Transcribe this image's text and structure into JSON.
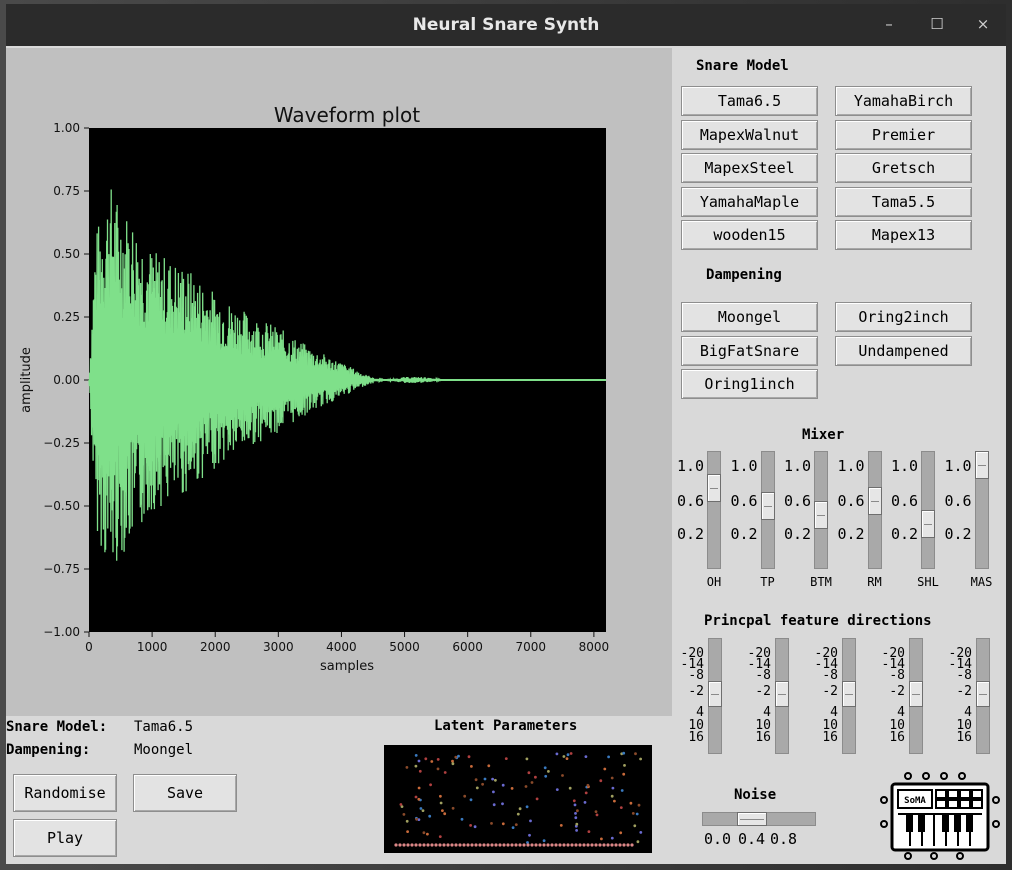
{
  "window": {
    "title": "Neural Snare Synth",
    "minimize": "–",
    "maximize": "☐",
    "close": "×"
  },
  "plot": {
    "title": "Waveform plot",
    "xlabel": "samples",
    "ylabel": "amplitude",
    "xticks": [
      "0",
      "1000",
      "2000",
      "3000",
      "4000",
      "5000",
      "6000",
      "7000",
      "8000"
    ],
    "yticks": [
      "1.00",
      "0.75",
      "0.50",
      "0.25",
      "0.00",
      "−0.25",
      "−0.50",
      "−0.75",
      "−1.00"
    ],
    "line_color": "#7fe08a",
    "background": "#000000"
  },
  "chart_data": {
    "type": "line",
    "title": "Waveform plot",
    "xlabel": "samples",
    "ylabel": "amplitude",
    "xlim": [
      0,
      8192
    ],
    "ylim": [
      -1.0,
      1.0
    ],
    "series": [
      {
        "color": "#7fe08a",
        "envelope": [
          {
            "x": 0,
            "y": 0.0
          },
          {
            "x": 100,
            "y": 0.58
          },
          {
            "x": 200,
            "y": 0.67
          },
          {
            "x": 330,
            "y": 0.79
          },
          {
            "x": 500,
            "y": 0.7
          },
          {
            "x": 700,
            "y": 0.65
          },
          {
            "x": 1000,
            "y": 0.52
          },
          {
            "x": 1500,
            "y": 0.46
          },
          {
            "x": 2000,
            "y": 0.35
          },
          {
            "x": 2500,
            "y": 0.27
          },
          {
            "x": 3000,
            "y": 0.21
          },
          {
            "x": 3500,
            "y": 0.13
          },
          {
            "x": 4000,
            "y": 0.07
          },
          {
            "x": 4400,
            "y": 0.02
          },
          {
            "x": 4700,
            "y": 0.0
          },
          {
            "x": 5000,
            "y": 0.02
          },
          {
            "x": 5300,
            "y": 0.02
          },
          {
            "x": 5600,
            "y": 0.0
          },
          {
            "x": 8192,
            "y": 0.0
          }
        ]
      }
    ]
  },
  "snare_model": {
    "heading": "Snare Model",
    "options": [
      "Tama6.5",
      "YamahaBirch",
      "MapexWalnut",
      "Premier",
      "MapexSteel",
      "Gretsch",
      "YamahaMaple",
      "Tama5.5",
      "wooden15",
      "Mapex13"
    ]
  },
  "dampening": {
    "heading": "Dampening",
    "options": [
      "Moongel",
      "Oring2inch",
      "BigFatSnare",
      "Undampened",
      "Oring1inch"
    ]
  },
  "mixer": {
    "heading": "Mixer",
    "ticks": [
      "1.0",
      "0.6",
      "0.2"
    ],
    "channels": [
      {
        "name": "OH",
        "value": 0.75
      },
      {
        "name": "TP",
        "value": 0.55
      },
      {
        "name": "BTM",
        "value": 0.45
      },
      {
        "name": "RM",
        "value": 0.6
      },
      {
        "name": "SHL",
        "value": 0.35
      },
      {
        "name": "MAS",
        "value": 1.0
      }
    ]
  },
  "principal": {
    "heading": "Princpal feature directions",
    "ticks": [
      "-20",
      "-14",
      "-8",
      "-2",
      "4",
      "10",
      "16"
    ],
    "values": [
      0,
      0,
      0,
      0,
      0
    ]
  },
  "status": {
    "snare_model_label": "Snare Model:",
    "snare_model_value": "Tama6.5",
    "dampening_label": "Dampening:",
    "dampening_value": "Moongel"
  },
  "latent": {
    "title": "Latent Parameters"
  },
  "actions": {
    "randomise": "Randomise",
    "save": "Save",
    "play": "Play"
  },
  "noise": {
    "heading": "Noise",
    "ticks": [
      "0.0",
      "0.4",
      "0.8"
    ],
    "value": 0.4
  },
  "logo": {
    "text": "SoMA"
  }
}
